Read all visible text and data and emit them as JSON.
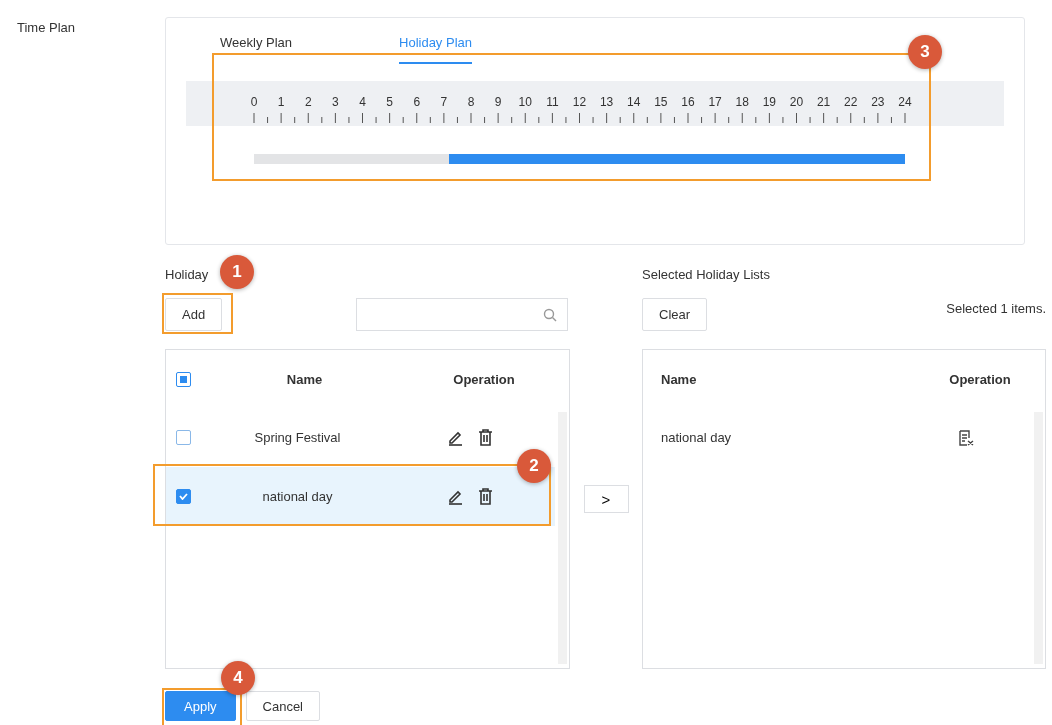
{
  "section_label": "Time Plan",
  "tabs": [
    {
      "label": "Weekly Plan",
      "selected": false
    },
    {
      "label": "Holiday Plan",
      "selected": true
    }
  ],
  "timeline": {
    "hours": [
      "0",
      "1",
      "2",
      "3",
      "4",
      "5",
      "6",
      "7",
      "8",
      "9",
      "10",
      "11",
      "12",
      "13",
      "14",
      "15",
      "16",
      "17",
      "18",
      "19",
      "20",
      "21",
      "22",
      "23",
      "24"
    ],
    "level": 0.7,
    "callout": "3"
  },
  "holiday": {
    "title": "Holiday",
    "callout": "1",
    "add_button": {
      "label": "Add"
    },
    "columns": [
      "Name",
      "Operation"
    ],
    "all_indeterminate": true,
    "rows": [
      {
        "name": "Spring Festival",
        "checked": false,
        "callout": null
      },
      {
        "name": "national day",
        "checked": true,
        "callout": "2"
      }
    ]
  },
  "transfer_button": {
    "label": ">"
  },
  "selected": {
    "title": "Selected Holiday Lists",
    "clear_button": {
      "label": "Clear"
    },
    "count": "Selected 1 items.",
    "columns": [
      "Name",
      "Operation"
    ],
    "rows": [
      {
        "name": "national day"
      }
    ]
  },
  "footer": {
    "apply": {
      "label": "Apply",
      "callout": "4"
    },
    "cancel": {
      "label": "Cancel"
    }
  }
}
